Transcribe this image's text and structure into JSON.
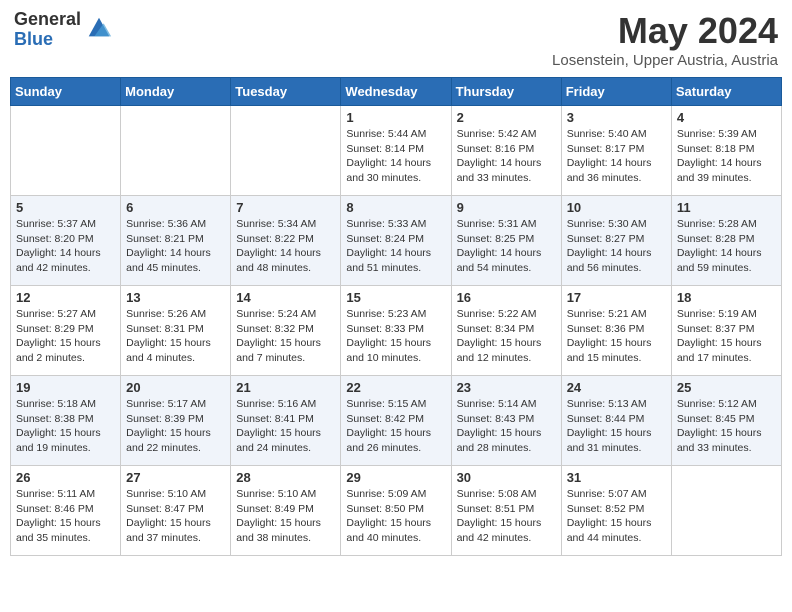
{
  "header": {
    "logo_general": "General",
    "logo_blue": "Blue",
    "title": "May 2024",
    "location": "Losenstein, Upper Austria, Austria"
  },
  "weekdays": [
    "Sunday",
    "Monday",
    "Tuesday",
    "Wednesday",
    "Thursday",
    "Friday",
    "Saturday"
  ],
  "weeks": [
    [
      {
        "day": "",
        "info": ""
      },
      {
        "day": "",
        "info": ""
      },
      {
        "day": "",
        "info": ""
      },
      {
        "day": "1",
        "info": "Sunrise: 5:44 AM\nSunset: 8:14 PM\nDaylight: 14 hours\nand 30 minutes."
      },
      {
        "day": "2",
        "info": "Sunrise: 5:42 AM\nSunset: 8:16 PM\nDaylight: 14 hours\nand 33 minutes."
      },
      {
        "day": "3",
        "info": "Sunrise: 5:40 AM\nSunset: 8:17 PM\nDaylight: 14 hours\nand 36 minutes."
      },
      {
        "day": "4",
        "info": "Sunrise: 5:39 AM\nSunset: 8:18 PM\nDaylight: 14 hours\nand 39 minutes."
      }
    ],
    [
      {
        "day": "5",
        "info": "Sunrise: 5:37 AM\nSunset: 8:20 PM\nDaylight: 14 hours\nand 42 minutes."
      },
      {
        "day": "6",
        "info": "Sunrise: 5:36 AM\nSunset: 8:21 PM\nDaylight: 14 hours\nand 45 minutes."
      },
      {
        "day": "7",
        "info": "Sunrise: 5:34 AM\nSunset: 8:22 PM\nDaylight: 14 hours\nand 48 minutes."
      },
      {
        "day": "8",
        "info": "Sunrise: 5:33 AM\nSunset: 8:24 PM\nDaylight: 14 hours\nand 51 minutes."
      },
      {
        "day": "9",
        "info": "Sunrise: 5:31 AM\nSunset: 8:25 PM\nDaylight: 14 hours\nand 54 minutes."
      },
      {
        "day": "10",
        "info": "Sunrise: 5:30 AM\nSunset: 8:27 PM\nDaylight: 14 hours\nand 56 minutes."
      },
      {
        "day": "11",
        "info": "Sunrise: 5:28 AM\nSunset: 8:28 PM\nDaylight: 14 hours\nand 59 minutes."
      }
    ],
    [
      {
        "day": "12",
        "info": "Sunrise: 5:27 AM\nSunset: 8:29 PM\nDaylight: 15 hours\nand 2 minutes."
      },
      {
        "day": "13",
        "info": "Sunrise: 5:26 AM\nSunset: 8:31 PM\nDaylight: 15 hours\nand 4 minutes."
      },
      {
        "day": "14",
        "info": "Sunrise: 5:24 AM\nSunset: 8:32 PM\nDaylight: 15 hours\nand 7 minutes."
      },
      {
        "day": "15",
        "info": "Sunrise: 5:23 AM\nSunset: 8:33 PM\nDaylight: 15 hours\nand 10 minutes."
      },
      {
        "day": "16",
        "info": "Sunrise: 5:22 AM\nSunset: 8:34 PM\nDaylight: 15 hours\nand 12 minutes."
      },
      {
        "day": "17",
        "info": "Sunrise: 5:21 AM\nSunset: 8:36 PM\nDaylight: 15 hours\nand 15 minutes."
      },
      {
        "day": "18",
        "info": "Sunrise: 5:19 AM\nSunset: 8:37 PM\nDaylight: 15 hours\nand 17 minutes."
      }
    ],
    [
      {
        "day": "19",
        "info": "Sunrise: 5:18 AM\nSunset: 8:38 PM\nDaylight: 15 hours\nand 19 minutes."
      },
      {
        "day": "20",
        "info": "Sunrise: 5:17 AM\nSunset: 8:39 PM\nDaylight: 15 hours\nand 22 minutes."
      },
      {
        "day": "21",
        "info": "Sunrise: 5:16 AM\nSunset: 8:41 PM\nDaylight: 15 hours\nand 24 minutes."
      },
      {
        "day": "22",
        "info": "Sunrise: 5:15 AM\nSunset: 8:42 PM\nDaylight: 15 hours\nand 26 minutes."
      },
      {
        "day": "23",
        "info": "Sunrise: 5:14 AM\nSunset: 8:43 PM\nDaylight: 15 hours\nand 28 minutes."
      },
      {
        "day": "24",
        "info": "Sunrise: 5:13 AM\nSunset: 8:44 PM\nDaylight: 15 hours\nand 31 minutes."
      },
      {
        "day": "25",
        "info": "Sunrise: 5:12 AM\nSunset: 8:45 PM\nDaylight: 15 hours\nand 33 minutes."
      }
    ],
    [
      {
        "day": "26",
        "info": "Sunrise: 5:11 AM\nSunset: 8:46 PM\nDaylight: 15 hours\nand 35 minutes."
      },
      {
        "day": "27",
        "info": "Sunrise: 5:10 AM\nSunset: 8:47 PM\nDaylight: 15 hours\nand 37 minutes."
      },
      {
        "day": "28",
        "info": "Sunrise: 5:10 AM\nSunset: 8:49 PM\nDaylight: 15 hours\nand 38 minutes."
      },
      {
        "day": "29",
        "info": "Sunrise: 5:09 AM\nSunset: 8:50 PM\nDaylight: 15 hours\nand 40 minutes."
      },
      {
        "day": "30",
        "info": "Sunrise: 5:08 AM\nSunset: 8:51 PM\nDaylight: 15 hours\nand 42 minutes."
      },
      {
        "day": "31",
        "info": "Sunrise: 5:07 AM\nSunset: 8:52 PM\nDaylight: 15 hours\nand 44 minutes."
      },
      {
        "day": "",
        "info": ""
      }
    ]
  ]
}
